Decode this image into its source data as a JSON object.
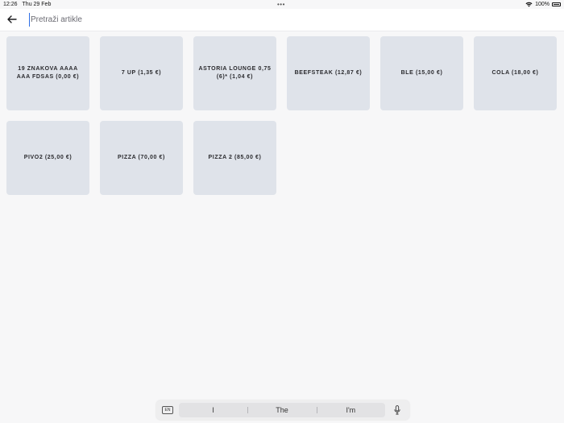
{
  "status_bar": {
    "time": "12:26",
    "date": "Thu 29 Feb",
    "dots": "•••",
    "battery": "100%"
  },
  "search": {
    "placeholder": "Pretraži artikle",
    "value": ""
  },
  "products": [
    {
      "label": "19 ZNAKOVA AAAA AAA FDSAS  (0,00 €)"
    },
    {
      "label": "7 UP  (1,35 €)"
    },
    {
      "label": "ASTORIA LOUNGE 0,75 (6)*  (1,04 €)"
    },
    {
      "label": "BEEFSTEAK  (12,87 €)"
    },
    {
      "label": "BLE  (15,00 €)"
    },
    {
      "label": "COLA  (18,00 €)"
    },
    {
      "label": "PIVO2  (25,00 €)"
    },
    {
      "label": "PIZZA  (70,00 €)"
    },
    {
      "label": "PIZZA 2  (85,00 €)"
    }
  ],
  "keyboard": {
    "language": "EN",
    "suggestions": [
      "I",
      "The",
      "I'm"
    ]
  },
  "colors": {
    "tile_background": "#dfe3ea",
    "cursor_accent": "#2f6fe6",
    "page_background": "#f7f7f8"
  }
}
